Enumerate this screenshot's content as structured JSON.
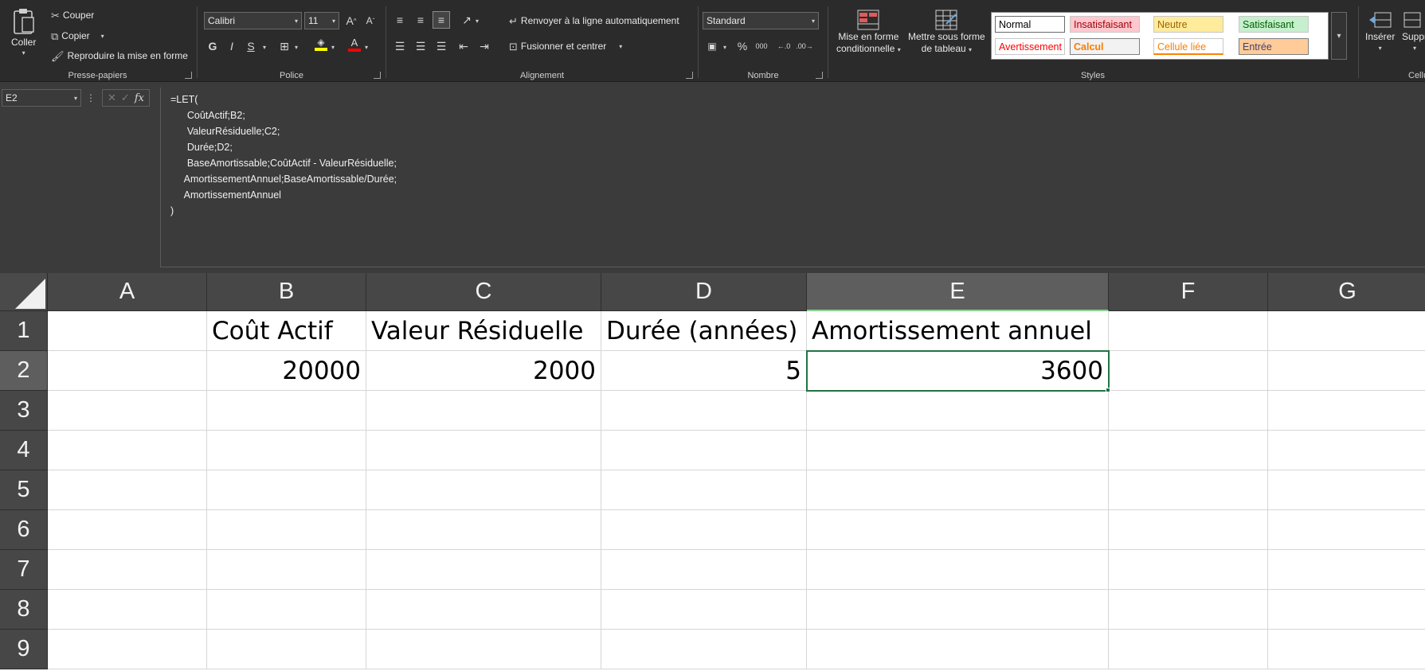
{
  "clipboard": {
    "paste_label": "Coller",
    "cut_label": "Couper",
    "copy_label": "Copier",
    "format_painter_label": "Reproduire la mise en forme",
    "group_label": "Presse-papiers"
  },
  "font": {
    "family": "Calibri",
    "size": "11",
    "bold": "G",
    "italic": "I",
    "underline": "S",
    "group_label": "Police"
  },
  "alignment": {
    "wrap_text_label": "Renvoyer à la ligne automatiquement",
    "merge_center_label": "Fusionner et centrer",
    "group_label": "Alignement"
  },
  "number": {
    "format": "Standard",
    "percent": "%",
    "thousands": "000",
    "group_label": "Nombre"
  },
  "styles": {
    "conditional_format_label_1": "Mise en forme",
    "conditional_format_label_2": "conditionnelle",
    "format_table_label_1": "Mettre sous forme",
    "format_table_label_2": "de tableau",
    "gallery": [
      {
        "label": "Normal",
        "bg": "#ffffff",
        "fg": "#000000"
      },
      {
        "label": "Insatisfaisant",
        "bg": "#ffc7ce",
        "fg": "#9c0006"
      },
      {
        "label": "Neutre",
        "bg": "#ffeb9c",
        "fg": "#9c6500"
      },
      {
        "label": "Satisfaisant",
        "bg": "#c6efce",
        "fg": "#006100"
      },
      {
        "label": "Avertissement",
        "bg": "#ffffff",
        "fg": "#ff0000"
      },
      {
        "label": "Calcul",
        "bg": "#f2f2f2",
        "fg": "#fa7d00"
      },
      {
        "label": "Cellule liée",
        "bg": "#ffffff",
        "fg": "#fa7d00"
      },
      {
        "label": "Entrée",
        "bg": "#ffcc99",
        "fg": "#3f3f76"
      }
    ],
    "group_label": "Styles"
  },
  "cells_group": {
    "insert_label": "Insérer",
    "delete_label": "Suppr",
    "group_label": "Cellu"
  },
  "formula_bar": {
    "name_box": "E2",
    "fx": "fx",
    "lines": [
      "=LET(",
      "      CoûtActif;B2;",
      "      ValeurRésiduelle;C2;",
      "      Durée;D2;",
      "      BaseAmortissable;CoûtActif - ValeurRésiduelle;",
      "     AmortissementAnnuel;BaseAmortissable/Durée;",
      "     AmortissementAnnuel",
      ")"
    ]
  },
  "sheet": {
    "columns": [
      "A",
      "B",
      "C",
      "D",
      "E",
      "F",
      "G"
    ],
    "rows": [
      "1",
      "2",
      "3",
      "4",
      "5",
      "6",
      "7",
      "8",
      "9"
    ],
    "headers": {
      "B1": "Coût Actif",
      "C1": "Valeur Résiduelle",
      "D1": "Durée (années)",
      "E1": "Amortissement annuel"
    },
    "values": {
      "B2": "20000",
      "C2": "2000",
      "D2": "5",
      "E2": "3600"
    },
    "selected_cell": "E2"
  },
  "colors": {
    "selection": "#217346",
    "font_color_bar": "#ff0000",
    "highlight_bar": "#ffff00"
  }
}
